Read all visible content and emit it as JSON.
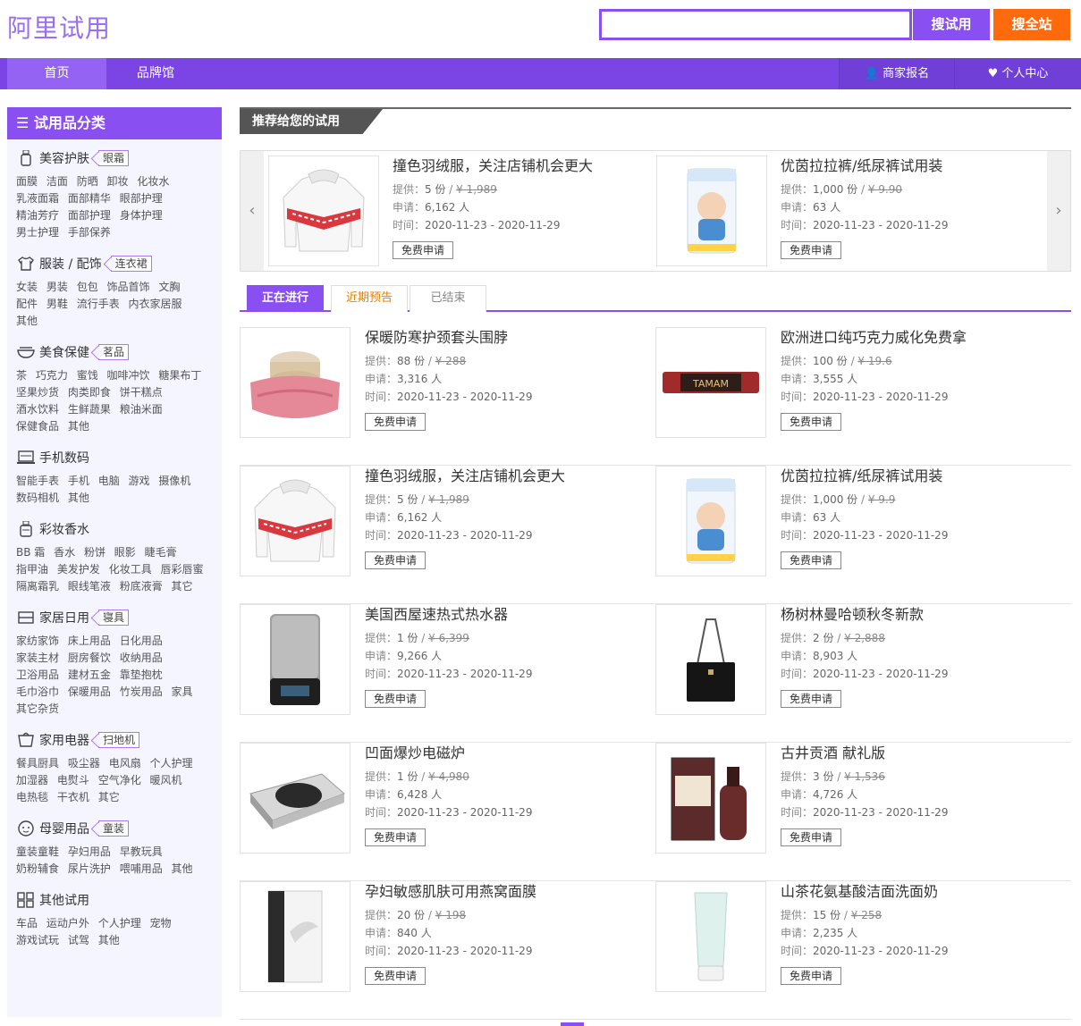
{
  "header": {
    "logo": "阿里试用",
    "search_value": "",
    "search_trial_label": "搜试用",
    "search_all_label": "搜全站"
  },
  "nav": {
    "home": "首页",
    "brand": "品牌馆",
    "merchant": "商家报名",
    "personal": "个人中心"
  },
  "sidebar": {
    "title": "试用品分类",
    "categories": [
      {
        "name": "美容护肤",
        "icon": "bottle-icon",
        "tag": "眼霜",
        "subs": [
          "面膜",
          "洁面",
          "防晒",
          "卸妆",
          "化妆水",
          "乳液面霜",
          "面部精华",
          "眼部护理",
          "精油芳疗",
          "面部护理",
          "身体护理",
          "男士护理",
          "手部保养"
        ]
      },
      {
        "name": "服装 / 配饰",
        "icon": "shirt-icon",
        "tag": "连衣裙",
        "subs": [
          "女装",
          "男装",
          "包包",
          "饰品首饰",
          "文胸",
          "配件",
          "男鞋",
          "流行手表",
          "内衣家居服",
          "其他"
        ]
      },
      {
        "name": "美食保健",
        "icon": "bowl-icon",
        "tag": "茗品",
        "subs": [
          "茶",
          "巧克力",
          "蜜饯",
          "咖啡冲饮",
          "糖果布丁",
          "坚果炒货",
          "肉类即食",
          "饼干糕点",
          "酒水饮料",
          "生鲜蔬果",
          "粮油米面",
          "保健食品",
          "其他"
        ]
      },
      {
        "name": "手机数码",
        "icon": "laptop-icon",
        "tag": "",
        "subs": [
          "智能手表",
          "手机",
          "电脑",
          "游戏",
          "摄像机",
          "数码相机",
          "其他"
        ]
      },
      {
        "name": "彩妆香水",
        "icon": "perfume-icon",
        "tag": "",
        "subs": [
          "BB 霜",
          "香水",
          "粉饼",
          "眼影",
          "睫毛膏",
          "指甲油",
          "美发护发",
          "化妆工具",
          "唇彩唇蜜",
          "隔离霜乳",
          "眼线笔液",
          "粉底液膏",
          "其它"
        ]
      },
      {
        "name": "家居日用",
        "icon": "sofa-icon",
        "tag": "寝具",
        "subs": [
          "家纺家饰",
          "床上用品",
          "日化用品",
          "家装主材",
          "厨房餐饮",
          "收纳用品",
          "卫浴用品",
          "建材五金",
          "靠垫抱枕",
          "毛巾浴巾",
          "保暖用品",
          "竹炭用品",
          "家具",
          "其它杂货"
        ]
      },
      {
        "name": "家用电器",
        "icon": "appliance-icon",
        "tag": "扫地机",
        "subs": [
          "餐具厨具",
          "吸尘器",
          "电风扇",
          "个人护理",
          "加湿器",
          "电熨斗",
          "空气净化",
          "暖风机",
          "电热毯",
          "干衣机",
          "其它"
        ]
      },
      {
        "name": "母婴用品",
        "icon": "baby-icon",
        "tag": "童装",
        "subs": [
          "童装童鞋",
          "孕妇用品",
          "早教玩具",
          "奶粉辅食",
          "尿片洗护",
          "喂哺用品",
          "其他"
        ]
      },
      {
        "name": "其他试用",
        "icon": "grid-icon",
        "tag": "",
        "subs": [
          "车品",
          "运动户外",
          "个人护理",
          "宠物",
          "游戏试玩",
          "试驾",
          "其他"
        ]
      }
    ]
  },
  "recommend": {
    "title": "推荐给您的试用",
    "items": [
      {
        "name": "撞色羽绒服，关注店铺机会更大",
        "qty": "5 份",
        "price": "¥ 1,989",
        "applicants": "6,162 人",
        "time": "2020-11-23 - 2020-11-29",
        "apply": "免费申请",
        "img": "jacket"
      },
      {
        "name": "优茵拉拉裤/纸尿裤试用装",
        "qty": "1,000 份",
        "price": "¥ 9.90",
        "applicants": "63 人",
        "time": "2020-11-23 - 2020-11-29",
        "apply": "免费申请",
        "img": "diaper"
      }
    ]
  },
  "labels": {
    "provide": "提供：",
    "apply_count": "申请：",
    "time": "时间："
  },
  "tabs": {
    "active": "正在进行",
    "upcoming": "近期预告",
    "ended": "已结束"
  },
  "products": [
    {
      "name": "保暖防寒护颈套头围脖",
      "qty": "88 份",
      "price": "¥ 288",
      "applicants": "3,316 人",
      "time": "2020-11-23 - 2020-11-29",
      "apply": "免费申请",
      "img": "scarf"
    },
    {
      "name": "欧洲进口纯巧克力威化免费拿",
      "qty": "100 份",
      "price": "¥ 19.6",
      "applicants": "3,555 人",
      "time": "2020-11-23 - 2020-11-29",
      "apply": "免费申请",
      "img": "wafer"
    },
    {
      "name": "撞色羽绒服，关注店铺机会更大",
      "qty": "5 份",
      "price": "¥ 1,989",
      "applicants": "6,162 人",
      "time": "2020-11-23 - 2020-11-29",
      "apply": "免费申请",
      "img": "jacket"
    },
    {
      "name": "优茵拉拉裤/纸尿裤试用装",
      "qty": "1,000 份",
      "price": "¥ 9.9",
      "applicants": "63 人",
      "time": "2020-11-23 - 2020-11-29",
      "apply": "免费申请",
      "img": "diaper"
    },
    {
      "name": "美国西屋速热式热水器",
      "qty": "1 份",
      "price": "¥ 6,399",
      "applicants": "9,266 人",
      "time": "2020-11-23 - 2020-11-29",
      "apply": "免费申请",
      "img": "heater"
    },
    {
      "name": "杨树林曼哈顿秋冬新款",
      "qty": "2 份",
      "price": "¥ 2,888",
      "applicants": "8,903 人",
      "time": "2020-11-23 - 2020-11-29",
      "apply": "免费申请",
      "img": "bag"
    },
    {
      "name": "凹面爆炒电磁炉",
      "qty": "1 份",
      "price": "¥ 4,980",
      "applicants": "6,428 人",
      "time": "2020-11-23 - 2020-11-29",
      "apply": "免费申请",
      "img": "cooker"
    },
    {
      "name": "古井贡酒 献礼版",
      "qty": "3 份",
      "price": "¥ 1,536",
      "applicants": "4,726 人",
      "time": "2020-11-23 - 2020-11-29",
      "apply": "免费申请",
      "img": "liquor"
    },
    {
      "name": "孕妇敏感肌肤可用燕窝面膜",
      "qty": "20 份",
      "price": "¥ 198",
      "applicants": "840 人",
      "time": "2020-11-23 - 2020-11-29",
      "apply": "免费申请",
      "img": "mask"
    },
    {
      "name": "山茶花氨基酸洁面洗面奶",
      "qty": "15 份",
      "price": "¥ 258",
      "applicants": "2,235 人",
      "time": "2020-11-23 - 2020-11-29",
      "apply": "免费申请",
      "img": "cleanser"
    }
  ]
}
